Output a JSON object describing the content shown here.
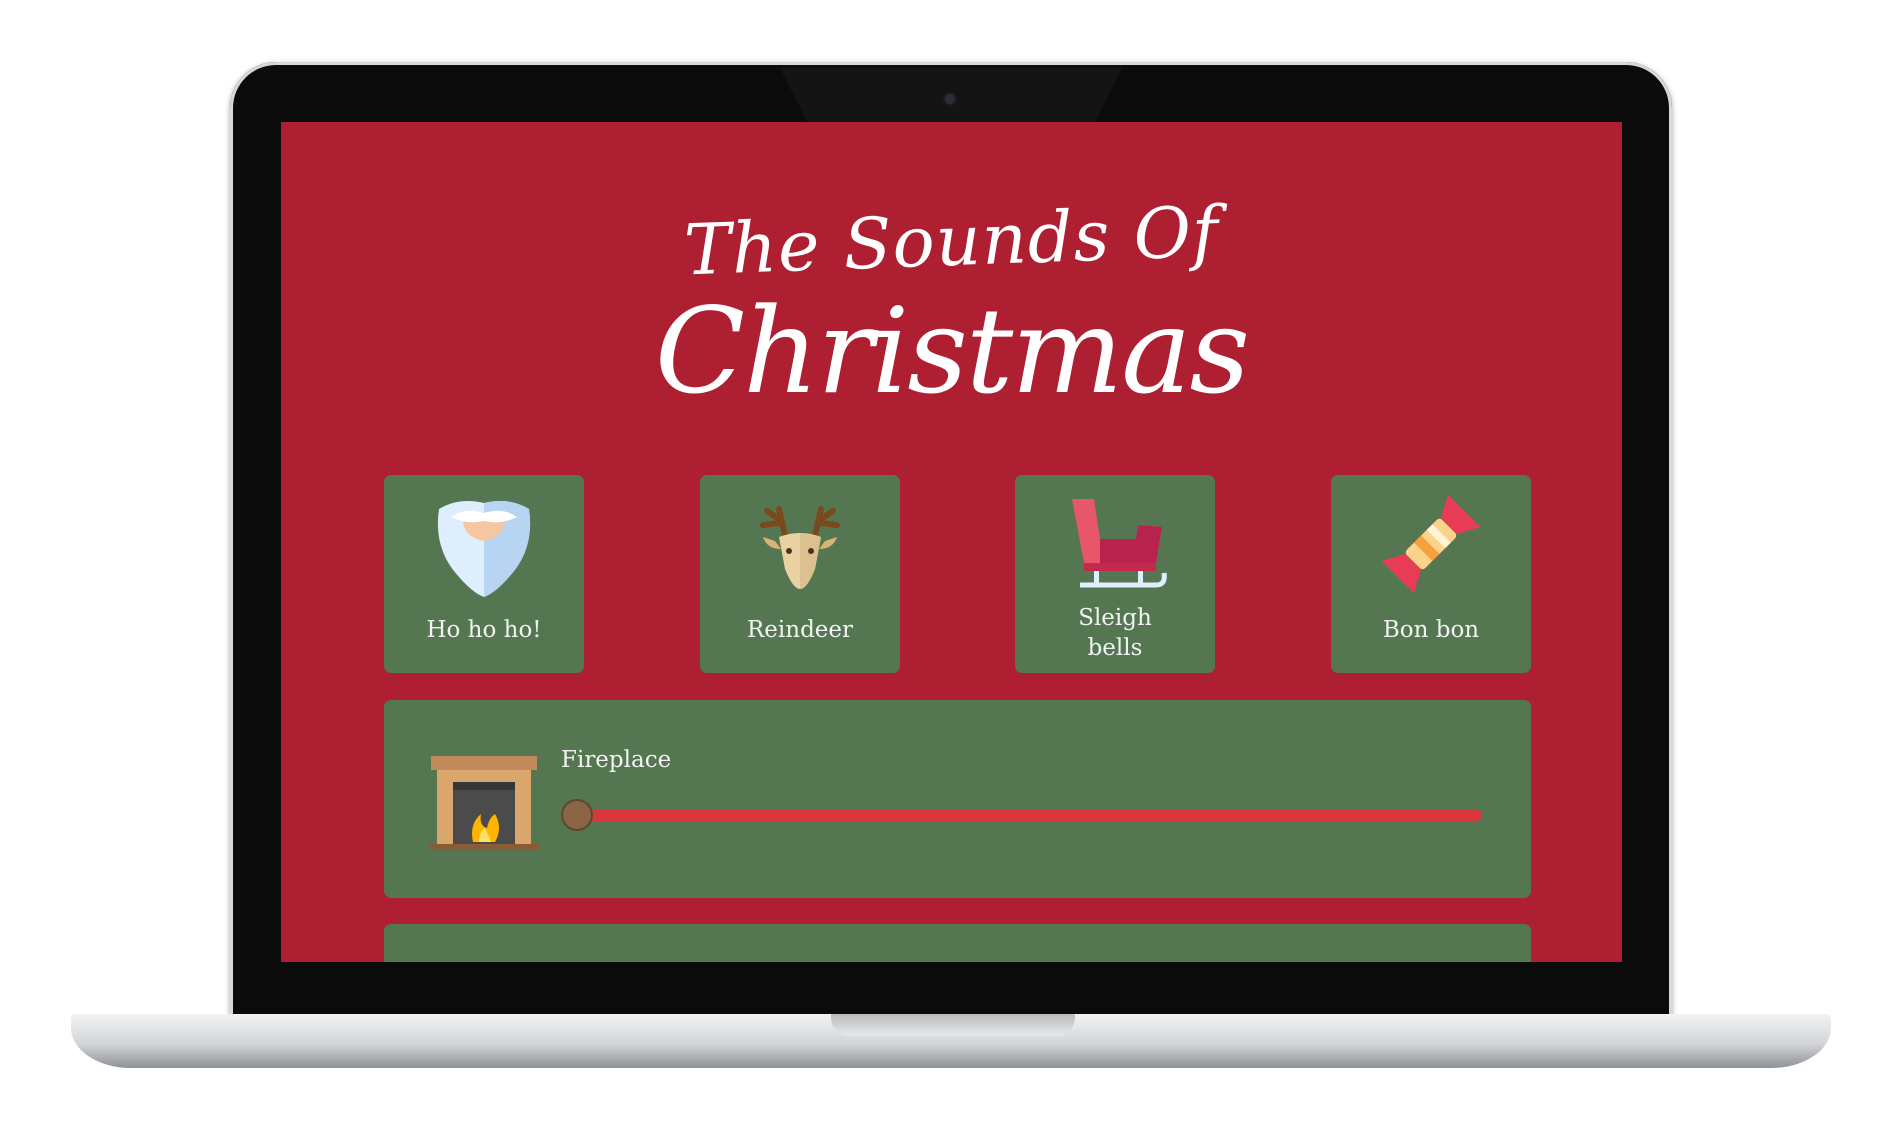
{
  "header": {
    "title_line1": "The Sounds Of",
    "title_line2": "Christmas"
  },
  "sounds": [
    {
      "label": "Ho ho ho!",
      "icon": "santa-beard-icon"
    },
    {
      "label": "Reindeer",
      "icon": "reindeer-icon"
    },
    {
      "label": "Sleigh bells",
      "icon": "sleigh-icon"
    },
    {
      "label": "Bon bon",
      "icon": "christmas-cracker-icon"
    }
  ],
  "ambient": [
    {
      "label": "Fireplace",
      "icon": "fireplace-icon",
      "volume": 0.0
    }
  ],
  "colors": {
    "background": "#ae1f32",
    "card": "#547752",
    "slider_track": "#d9373c",
    "slider_thumb": "#8a6646"
  }
}
